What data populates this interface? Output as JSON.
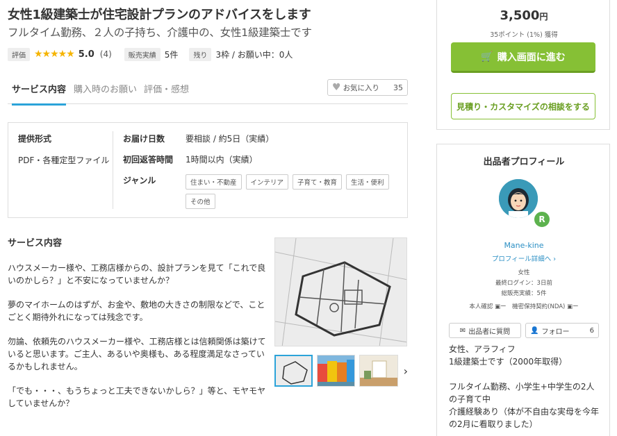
{
  "title": "女性1級建築士が住宅設計プランのアドバイスをします",
  "subtitle": "フルタイム勤務、２人の子持ち、介護中の、女性1級建築士です",
  "meta": {
    "rating_tag": "評価",
    "stars": "★★★★★",
    "rating": "5.0",
    "rating_count": "(4)",
    "sales_tag": "販売実績",
    "sales": "5件",
    "remain_tag": "残り",
    "remain": "3枠 / お願い中：0人"
  },
  "tabs": [
    {
      "label": "サービス内容"
    },
    {
      "label": "購入時のお願い"
    },
    {
      "label": "評価・感想"
    }
  ],
  "favorite": {
    "label": "お気に入り",
    "count": "35",
    "icon": "heart-icon"
  },
  "spec": {
    "format_h": "提供形式",
    "format_v": "PDF・各種定型ファイル",
    "rows": [
      {
        "k": "お届け日数",
        "v": "要相談 / 約5日（実績）"
      },
      {
        "k": "初回返答時間",
        "v": "1時間以内（実績）"
      },
      {
        "k": "ジャンル",
        "v": ""
      }
    ],
    "genres": [
      "住まい・不動産",
      "インテリア",
      "子育て・教育",
      "生活・便利",
      "その他"
    ]
  },
  "description": {
    "heading": "サービス内容",
    "paragraphs": [
      "ハウスメーカー様や、工務店様からの、設計プランを見て「これで良いのかしら？」と不安になっていませんか？",
      "夢のマイホームのはずが、お金や、敷地の大きさの制限などで、ことごとく期待外れになっては残念です。",
      "勿論、依頼先のハウスメーカー様や、工務店様とは信頼関係は築けていると思います。ご主人、あるいや奥様も、ある程度満足なさっているかもしれません。",
      "「でも・・・、もうちょっと工夫できないかしら？」等と、モヤモヤしていませんか？"
    ]
  },
  "purchase": {
    "price": "3,500",
    "unit": "円",
    "points": "35ポイント (1%) 獲得",
    "buy_label": "購入画面に進む",
    "consult_label": "見積り・カスタマイズの相談をする"
  },
  "profile": {
    "heading": "出品者プロフィール",
    "rank": "R",
    "name": "Mane-kine",
    "link": "プロフィール詳細へ ›",
    "gender": "女性",
    "last_login": "最終ログイン：3日前",
    "total_sales": "総販売実績：5件",
    "verify": "本人確認 ▣ー　機密保持契約(NDA) ▣ー",
    "message_label": "出品者に質問",
    "follow_label": "フォロー",
    "follow_count": "6",
    "bio": [
      "女性、アラフィフ\n1級建築士です（2000年取得）",
      "フルタイム勤務、小学生+中学生の2人の子育て中\n介護経験あり（体が不自由な実母を今年の2月に看取りました）"
    ]
  },
  "colors": {
    "accent": "#2ba3d9",
    "buy": "#86c035",
    "star": "#f5b400"
  }
}
